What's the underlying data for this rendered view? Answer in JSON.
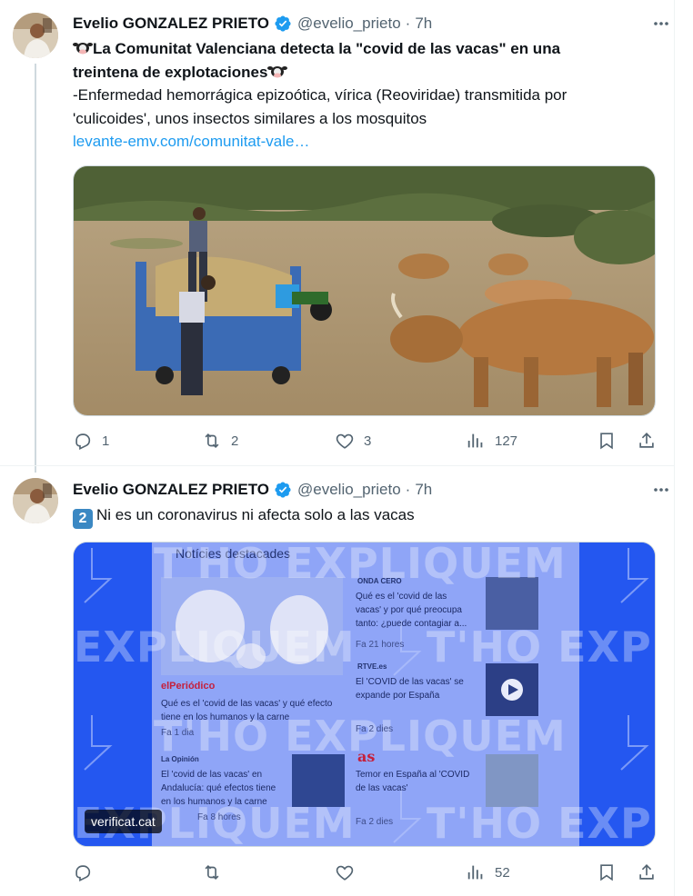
{
  "tweets": [
    {
      "author": "Evelio GONZALEZ PRIETO",
      "handle": "@evelio_prieto",
      "separator": "·",
      "time": "7h",
      "headline_line1": "La Comunitat Valenciana detecta la \"covid de las vacas\" en una",
      "headline_line2": "treintena de explotaciones",
      "body_line1": "-Enfermedad hemorrágica epizoótica, vírica (Reoviridae) transmitida por",
      "body_line2": "'culicoides', unos insectos similares a los mosquitos",
      "link": "levante-emv.com/comunitat-vale…",
      "replies": "1",
      "reposts": "2",
      "likes": "3",
      "views": "127"
    },
    {
      "author": "Evelio GONZALEZ PRIETO",
      "handle": "@evelio_prieto",
      "separator": "·",
      "time": "7h",
      "text": "Ni es un coronavirus ni afecta solo a las vacas",
      "badge": "2",
      "views": "52",
      "image": {
        "watermark": "T'HO EXPLIQUEM",
        "watermark_alt": "EXPLIQUEM",
        "panel_title": "Notícies destacades",
        "news": [
          {
            "source": "elPeriódico",
            "title_line1": "Qué es el 'covid de las vacas' y qué efecto",
            "title_line2": "tiene en los humanos y la carne",
            "age": "Fa 1 dia"
          },
          {
            "source": "ONDA CERO",
            "title_line1": "Qué es el 'covid de las",
            "title_line2": "vacas' y por qué preocupa",
            "title_line3": "tanto: ¿puede contagiar a...",
            "age": "Fa 21 hores"
          },
          {
            "source": "RTVE.es",
            "title_line1": "El 'COVID de las vacas' se",
            "title_line2": "expande por España",
            "age": "Fa 2 dies"
          },
          {
            "source": "La Opinión",
            "title_line1": "El 'covid de las vacas' en",
            "title_line2": "Andalucía: qué efectos tiene",
            "title_line3": "en los humanos y la carne",
            "age": "Fa 8 hores"
          },
          {
            "source": "as",
            "title_line1": "Temor en España al 'COVID",
            "title_line2": "de las vacas'",
            "age": "Fa 2 dies"
          }
        ],
        "credit": "verificat.cat"
      }
    }
  ],
  "colors": {
    "text": "#0f1419",
    "muted": "#536471",
    "link": "#1d9bf0",
    "verified": "#1d9bf0",
    "overlay_blue": "#1f4ff5"
  }
}
